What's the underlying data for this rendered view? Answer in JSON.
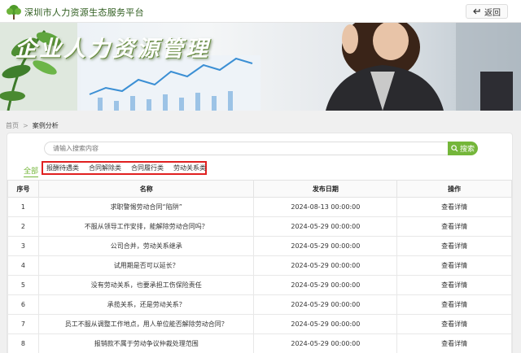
{
  "header": {
    "site_title": "深圳市人力资源生态服务平台",
    "back_label": "返回"
  },
  "banner": {
    "title": "企业人力资源管理"
  },
  "breadcrumb": {
    "home": "首页",
    "separator": ">",
    "current": "案例分析"
  },
  "search": {
    "placeholder": "请输入搜索内容",
    "button_label": "搜索"
  },
  "categories": {
    "all_label": "全部",
    "items": [
      "报酬待遇类",
      "合同解除类",
      "合同履行类",
      "劳动关系类"
    ]
  },
  "table": {
    "headers": [
      "序号",
      "名称",
      "发布日期",
      "操作"
    ],
    "rows": [
      {
        "no": "1",
        "name": "求职警惕劳动合同“陷阱”",
        "date": "2024-08-13 00:00:00",
        "action": "查看详情"
      },
      {
        "no": "2",
        "name": "不服从领导工作安排，能解除劳动合同吗？",
        "date": "2024-05-29 00:00:00",
        "action": "查看详情"
      },
      {
        "no": "3",
        "name": "公司合并，劳动关系继承",
        "date": "2024-05-29 00:00:00",
        "action": "查看详情"
      },
      {
        "no": "4",
        "name": "试用期是否可以延长？",
        "date": "2024-05-29 00:00:00",
        "action": "查看详情"
      },
      {
        "no": "5",
        "name": "没有劳动关系，也要承担工伤保险责任",
        "date": "2024-05-29 00:00:00",
        "action": "查看详情"
      },
      {
        "no": "6",
        "name": "承揽关系，还是劳动关系？",
        "date": "2024-05-29 00:00:00",
        "action": "查看详情"
      },
      {
        "no": "7",
        "name": "员工不服从调整工作地点，用人单位能否解除劳动合同？",
        "date": "2024-05-29 00:00:00",
        "action": "查看详情"
      },
      {
        "no": "8",
        "name": "报销款不属于劳动争议仲裁处理范围",
        "date": "2024-05-29 00:00:00",
        "action": "查看详情"
      }
    ]
  },
  "colors": {
    "accent": "#74b63a",
    "highlight_border": "#e02020"
  }
}
